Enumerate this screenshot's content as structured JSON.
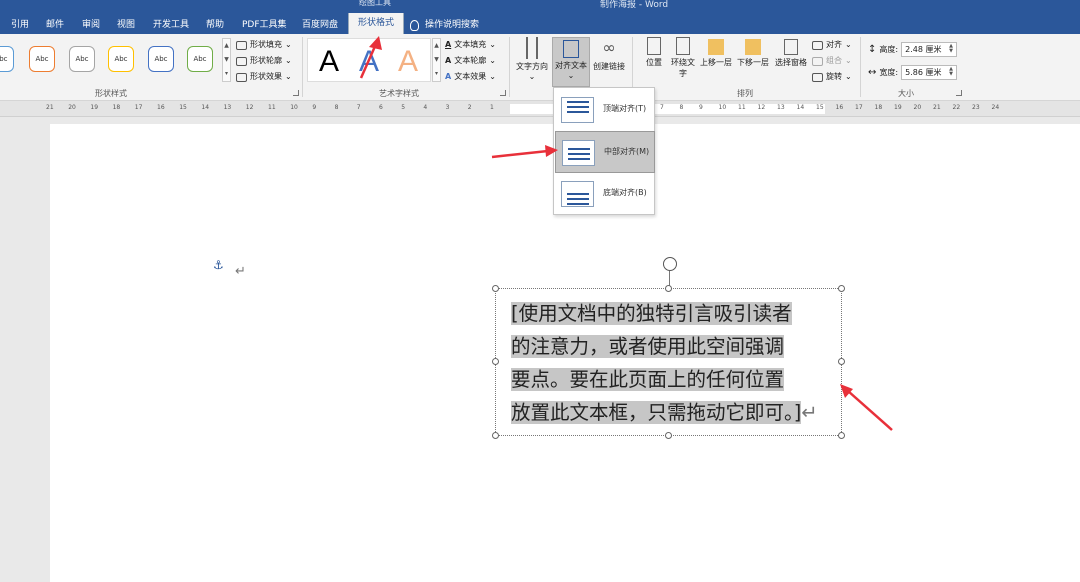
{
  "titlebar": {
    "context_label": "绘图工具",
    "doc_title": "制作海报 - Word"
  },
  "tabs": [
    "引用",
    "邮件",
    "审阅",
    "视图",
    "开发工具",
    "帮助",
    "PDF工具集",
    "百度网盘",
    "形状格式"
  ],
  "active_tab": "形状格式",
  "tell_me": "操作说明搜索",
  "shape_styles": {
    "swatch_text": "Abc",
    "swatch_colors": [
      "#5b9bd5",
      "#ed7d31",
      "#a5a5a5",
      "#ffc000",
      "#4472c4",
      "#70ad47"
    ],
    "fill": "形状填充",
    "outline": "形状轮廓",
    "effects": "形状效果",
    "group_label": "形状样式"
  },
  "wordart": {
    "letter": "A",
    "text_fill": "文本填充",
    "text_outline": "文本轮廓",
    "text_effects": "文本效果",
    "group_label": "艺术字样式"
  },
  "text_group": {
    "direction": "文字方向",
    "align_text": "对齐文本",
    "create_link": "创建链接"
  },
  "arrange": {
    "position": "位置",
    "wrap_text": "环绕文字",
    "bring_forward": "上移一层",
    "send_backward": "下移一层",
    "selection_pane": "选择窗格",
    "align": "对齐",
    "group": "组合",
    "rotate": "旋转",
    "group_label": "排列"
  },
  "size": {
    "height_label": "高度:",
    "height_value": "2.48 厘米",
    "width_label": "宽度:",
    "width_value": "5.86 厘米",
    "group_label": "大小"
  },
  "dropdown": {
    "items": [
      "顶端对齐(T)",
      "中部对齐(M)",
      "底端对齐(B)"
    ],
    "selected_index": 1
  },
  "ruler": {
    "left_labels": [
      "21",
      "20",
      "19",
      "18",
      "17",
      "16",
      "15",
      "14",
      "13",
      "12",
      "11",
      "10",
      "9",
      "8",
      "7",
      "6",
      "5",
      "4",
      "3",
      "2",
      "1"
    ],
    "right_labels": [
      "7",
      "8",
      "9",
      "10",
      "11",
      "12",
      "13",
      "14",
      "15",
      "16",
      "17",
      "18",
      "19",
      "20",
      "21",
      "22",
      "23",
      "24"
    ]
  },
  "document": {
    "textbox_text": "[使用文档中的独特引言吸引读者的注意力，或者使用此空间强调要点。要在此页面上的任何位置放置此文本框，只需拖动它即可。]",
    "textbox_lines": [
      "[使用文档中的独特引言吸引读者",
      "的注意力，或者使用此空间强调",
      "要点。要在此页面上的任何位置",
      "放置此文本框，只需拖动它即可。]"
    ],
    "para_mark": "↵",
    "anchor_icon": "⚓"
  },
  "annotation_color": "#e8303a"
}
